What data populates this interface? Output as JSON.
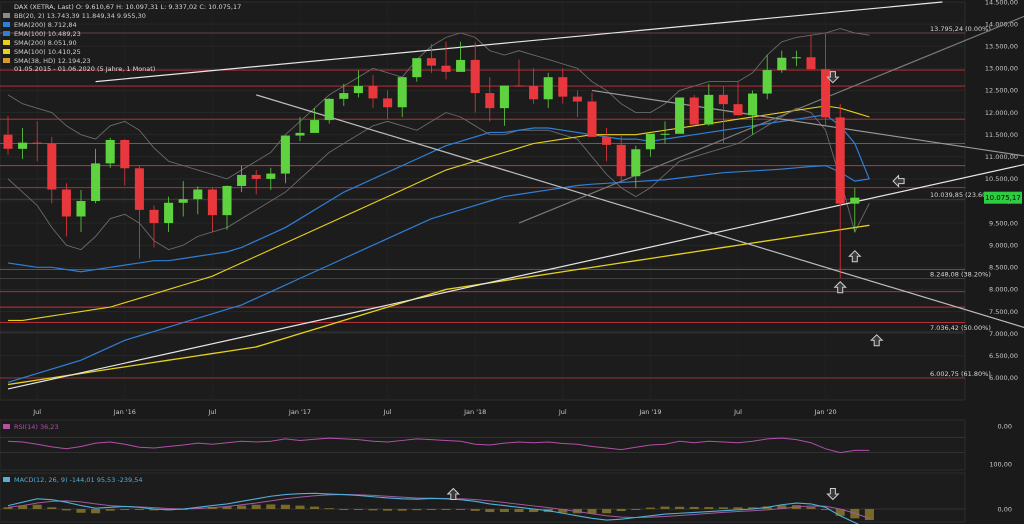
{
  "header": {
    "symbol_line": "DAX (XETRA, Last)  O: 9.610,67  H: 10.097,31  L: 9.337,02  C: 10.075,17",
    "date_range": "01.05.2015 - 01.06.2020  (5 Jahre, 1 Monat)"
  },
  "legend": [
    {
      "text": "BB(20, 2)  13.743,39  11.849,34  9.955,30",
      "color": "#8a8a8a"
    },
    {
      "text": "EMA(200)  8.712,84",
      "color": "#2f7fd6"
    },
    {
      "text": "EMA(100)  10.489,23",
      "color": "#2f7fd6"
    },
    {
      "text": "SMA(200)  8.051,90",
      "color": "#e6d21a"
    },
    {
      "text": "SMA(100)  10.410,25",
      "color": "#e6d21a"
    },
    {
      "text": "SMA(38, HD)  12.194,23",
      "color": "#d89c2a"
    }
  ],
  "last_price": {
    "label": "10.075,17",
    "color": "#2ecc40"
  },
  "colors": {
    "background": "#1a1a1a",
    "up": "#5fd33f",
    "down": "#e8383d",
    "hline": "#c8323a",
    "trend": "#e6e6e6",
    "bb": "#6a6a6a",
    "ema": "#2f7fd6",
    "sma": "#e6d21a",
    "sma38": "#c9962c",
    "rsi": "#b24fa8",
    "macd": "#4fb0d8",
    "signal": "#a05aa0",
    "hist": "#7a6a2a"
  },
  "chart_data": [
    {
      "type": "candlestick",
      "title": "DAX (XETRA, Last)",
      "y_scale": "linear",
      "ylim": [
        5500,
        14500
      ],
      "y_ticks": [
        14500,
        14000,
        13500,
        13000,
        12500,
        12000,
        11500,
        11000,
        10500,
        10000,
        9500,
        9000,
        8500,
        8000,
        7500,
        7000,
        6500,
        6000
      ],
      "y_tick_labels": [
        "14.500,00",
        "14.000,00",
        "13.500,00",
        "13.000,00",
        "12.500,00",
        "12.000,00",
        "11.500,00",
        "11.000,00",
        "10.500,00",
        "10.000,00",
        "9.500,00",
        "9.000,00",
        "8.500,00",
        "8.000,00",
        "7.500,00",
        "7.000,00",
        "6.500,00",
        "6.000,00"
      ],
      "x_labels": [
        {
          "label": "Jul",
          "month_index": 2
        },
        {
          "label": "Jan '16",
          "month_index": 8
        },
        {
          "label": "Jul",
          "month_index": 14
        },
        {
          "label": "Jan '17",
          "month_index": 20
        },
        {
          "label": "Jul",
          "month_index": 26
        },
        {
          "label": "Jan '18",
          "month_index": 32
        },
        {
          "label": "Jul",
          "month_index": 38
        },
        {
          "label": "Jan '19",
          "month_index": 44
        },
        {
          "label": "Jul",
          "month_index": 50
        },
        {
          "label": "Jan '20",
          "month_index": 56
        }
      ],
      "x_range_months": [
        0,
        65
      ],
      "candles": [
        [
          11500,
          11920,
          11050,
          11180
        ],
        [
          11180,
          11650,
          10950,
          11320
        ],
        [
          11320,
          11800,
          10900,
          11300
        ],
        [
          11300,
          11450,
          9950,
          10260
        ],
        [
          10260,
          10400,
          9200,
          9650
        ],
        [
          9650,
          10250,
          9300,
          10000
        ],
        [
          10000,
          11180,
          9950,
          10850
        ],
        [
          10850,
          11430,
          10750,
          11380
        ],
        [
          11380,
          11400,
          10350,
          10740
        ],
        [
          10740,
          10800,
          8700,
          9800
        ],
        [
          9800,
          9900,
          8950,
          9500
        ],
        [
          9500,
          10100,
          9300,
          9960
        ],
        [
          9960,
          10450,
          9650,
          10040
        ],
        [
          10040,
          10330,
          9700,
          10260
        ],
        [
          10260,
          10300,
          9300,
          9680
        ],
        [
          9680,
          10350,
          9350,
          10340
        ],
        [
          10340,
          10800,
          10200,
          10590
        ],
        [
          10590,
          10700,
          10150,
          10500
        ],
        [
          10500,
          10750,
          10250,
          10620
        ],
        [
          10620,
          11480,
          10400,
          11480
        ],
        [
          11480,
          11900,
          11350,
          11540
        ],
        [
          11540,
          12100,
          11600,
          11830
        ],
        [
          11830,
          12330,
          11750,
          12310
        ],
        [
          12310,
          12650,
          12150,
          12440
        ],
        [
          12440,
          12950,
          12340,
          12600
        ],
        [
          12600,
          12850,
          12100,
          12320
        ],
        [
          12320,
          12500,
          11850,
          12120
        ],
        [
          12120,
          12650,
          11900,
          12800
        ],
        [
          12800,
          13200,
          12700,
          13230
        ],
        [
          13230,
          13550,
          12900,
          13060
        ],
        [
          13060,
          13600,
          12750,
          12920
        ],
        [
          12920,
          13600,
          13050,
          13190
        ],
        [
          13190,
          13590,
          12000,
          12440
        ],
        [
          12440,
          12800,
          11800,
          12100
        ],
        [
          12100,
          12500,
          11700,
          12610
        ],
        [
          12610,
          13200,
          12600,
          12600
        ],
        [
          12600,
          13000,
          12200,
          12300
        ],
        [
          12300,
          12900,
          12100,
          12800
        ],
        [
          12800,
          13000,
          12200,
          12360
        ],
        [
          12360,
          12500,
          11900,
          12250
        ],
        [
          12250,
          12450,
          11500,
          11450
        ],
        [
          11450,
          11650,
          10900,
          11270
        ],
        [
          11270,
          11500,
          10400,
          10560
        ],
        [
          10560,
          11250,
          10300,
          11170
        ],
        [
          11170,
          11350,
          11000,
          11520
        ],
        [
          11520,
          11800,
          11300,
          11520
        ],
        [
          11520,
          12300,
          11600,
          12340
        ],
        [
          12340,
          12400,
          11800,
          11730
        ],
        [
          11730,
          12650,
          11700,
          12400
        ],
        [
          12400,
          12600,
          11300,
          12190
        ],
        [
          12190,
          12700,
          12000,
          11940
        ],
        [
          11940,
          12500,
          11500,
          12430
        ],
        [
          12430,
          13300,
          12300,
          12960
        ],
        [
          12960,
          13400,
          12900,
          13240
        ],
        [
          13240,
          13400,
          13050,
          13250
        ],
        [
          13250,
          13760,
          13100,
          12980
        ],
        [
          12980,
          13790,
          11700,
          11890
        ],
        [
          11890,
          12200,
          8250,
          9940
        ],
        [
          9940,
          10300,
          9300,
          10075
        ]
      ],
      "horizontal_lines": [
        13800,
        12960,
        12600,
        11850,
        11300,
        10800,
        10300,
        8450,
        7950,
        7600,
        7250,
        6000
      ],
      "fib_levels": [
        {
          "label": "13.795,24 (0.00%)",
          "value": 13800
        },
        {
          "label": "10.039,85 (23.60%)",
          "value": 10040
        },
        {
          "label": "8.248,08 (38.20%)",
          "value": 8250
        },
        {
          "label": "7.036,42 (50.00%)",
          "value": 7036
        },
        {
          "label": "6.002,75 (61.80%)",
          "value": 6003
        }
      ],
      "trendlines": [
        {
          "from": [
            6,
            12700
          ],
          "to": [
            64,
            14500
          ],
          "color": "#e6e6e6"
        },
        {
          "from": [
            0,
            5750
          ],
          "to": [
            72,
            11000
          ],
          "color": "#e6e6e6"
        },
        {
          "from": [
            17,
            12400
          ],
          "to": [
            72,
            6900
          ],
          "color": "#bdbdbd"
        },
        {
          "from": [
            40,
            12500
          ],
          "to": [
            72,
            10900
          ],
          "color": "#9a9a9a"
        },
        {
          "from": [
            35,
            9500
          ],
          "to": [
            72,
            14500
          ],
          "color": "#7a7a7a"
        }
      ],
      "ema200": [
        5900,
        6000,
        6100,
        6200,
        6300,
        6400,
        6550,
        6700,
        6850,
        6950,
        7050,
        7150,
        7250,
        7350,
        7450,
        7550,
        7650,
        7800,
        7950,
        8100,
        8250,
        8400,
        8550,
        8700,
        8850,
        9000,
        9150,
        9300,
        9450,
        9600,
        9700,
        9800,
        9900,
        10000,
        10100,
        10150,
        10200,
        10250,
        10300,
        10350,
        10380,
        10400,
        10420,
        10440,
        10460,
        10480,
        10520,
        10560,
        10600,
        10640,
        10660,
        10680,
        10700,
        10720,
        10750,
        10780,
        10800,
        10650,
        10450,
        10500
      ],
      "ema100": [
        8600,
        8550,
        8500,
        8500,
        8450,
        8400,
        8450,
        8500,
        8550,
        8600,
        8650,
        8650,
        8700,
        8750,
        8800,
        8850,
        8950,
        9100,
        9250,
        9400,
        9600,
        9800,
        10000,
        10200,
        10350,
        10500,
        10650,
        10800,
        10950,
        11100,
        11250,
        11350,
        11450,
        11550,
        11550,
        11600,
        11650,
        11650,
        11600,
        11550,
        11500,
        11450,
        11400,
        11400,
        11350,
        11400,
        11450,
        11500,
        11550,
        11600,
        11650,
        11700,
        11750,
        11800,
        11850,
        11900,
        11950,
        11700,
        11300,
        10490
      ],
      "sma200": [
        5850,
        5900,
        5950,
        6000,
        6050,
        6100,
        6150,
        6200,
        6250,
        6300,
        6350,
        6400,
        6450,
        6500,
        6550,
        6600,
        6650,
        6700,
        6800,
        6900,
        7000,
        7100,
        7200,
        7300,
        7400,
        7500,
        7600,
        7700,
        7800,
        7900,
        8000,
        8050,
        8100,
        8150,
        8200,
        8250,
        8300,
        8350,
        8400,
        8450,
        8500,
        8550,
        8600,
        8650,
        8700,
        8750,
        8800,
        8850,
        8900,
        8950,
        9000,
        9050,
        9100,
        9150,
        9200,
        9250,
        9300,
        9350,
        9400,
        9450
      ],
      "sma100": [
        7300,
        7300,
        7350,
        7400,
        7450,
        7500,
        7550,
        7600,
        7700,
        7800,
        7900,
        8000,
        8100,
        8200,
        8300,
        8450,
        8600,
        8750,
        8900,
        9050,
        9200,
        9350,
        9500,
        9650,
        9800,
        9950,
        10100,
        10250,
        10400,
        10550,
        10700,
        10800,
        10900,
        11000,
        11100,
        11200,
        11300,
        11350,
        11400,
        11450,
        11500,
        11500,
        11500,
        11500,
        11550,
        11600,
        11650,
        11700,
        11750,
        11800,
        11850,
        11900,
        11950,
        12000,
        12050,
        12100,
        12150,
        12100,
        12000,
        11900
      ],
      "bb_upper": [
        12400,
        12200,
        12100,
        12000,
        11700,
        11500,
        11400,
        11700,
        11800,
        11600,
        11200,
        10900,
        10800,
        10700,
        10600,
        10500,
        10700,
        10900,
        11100,
        11500,
        11800,
        12100,
        12400,
        12600,
        12800,
        13000,
        12900,
        12800,
        13200,
        13500,
        13700,
        13800,
        13700,
        13400,
        13300,
        13400,
        13300,
        13200,
        13100,
        13000,
        12700,
        12500,
        12200,
        12000,
        12000,
        12200,
        12500,
        12600,
        12700,
        12700,
        12700,
        12900,
        13300,
        13600,
        13700,
        13750,
        13800,
        13900,
        13800,
        13750
      ],
      "bb_lower": [
        10500,
        10200,
        9900,
        9400,
        9000,
        8900,
        9200,
        9600,
        9700,
        9500,
        9100,
        8900,
        9000,
        9200,
        9300,
        9400,
        9600,
        9800,
        10000,
        10200,
        10500,
        10800,
        11100,
        11300,
        11500,
        11700,
        11800,
        11700,
        11600,
        11800,
        12000,
        11900,
        11700,
        11500,
        11500,
        11600,
        11600,
        11600,
        11500,
        11400,
        11000,
        10600,
        10300,
        10100,
        10300,
        10600,
        10900,
        11000,
        11100,
        11200,
        11300,
        11500,
        11700,
        11900,
        12100,
        12000,
        11600,
        10500,
        9300,
        9950
      ],
      "markers": [
        {
          "month": 56.5,
          "value": 12800,
          "direction": "down"
        },
        {
          "month": 61,
          "value": 10450,
          "direction": "left"
        },
        {
          "month": 58,
          "value": 8750,
          "direction": "up"
        },
        {
          "month": 57,
          "value": 8050,
          "direction": "up"
        },
        {
          "month": 59.5,
          "value": 6850,
          "direction": "up"
        }
      ]
    },
    {
      "type": "line",
      "title": "RSI(14)  36,23",
      "ylim": [
        0,
        100
      ],
      "y_tick_labels": [
        "100,00",
        "0,00"
      ],
      "values": [
        60,
        58,
        52,
        45,
        40,
        46,
        55,
        58,
        52,
        44,
        42,
        46,
        50,
        55,
        52,
        56,
        60,
        58,
        60,
        66,
        62,
        65,
        68,
        66,
        64,
        60,
        58,
        62,
        66,
        64,
        62,
        60,
        52,
        50,
        55,
        58,
        56,
        58,
        54,
        52,
        46,
        42,
        38,
        44,
        50,
        52,
        60,
        56,
        60,
        58,
        56,
        60,
        66,
        68,
        64,
        56,
        40,
        30,
        36,
        36
      ]
    },
    {
      "type": "bar+line",
      "title": "MACD(12, 26, 9)  -144,01  95,53  -239,54",
      "y_tick_labels": [
        "0,00"
      ],
      "macd": [
        20,
        40,
        60,
        55,
        40,
        20,
        5,
        10,
        15,
        10,
        0,
        -5,
        0,
        10,
        20,
        30,
        45,
        60,
        75,
        85,
        90,
        92,
        88,
        85,
        80,
        72,
        65,
        60,
        58,
        62,
        60,
        55,
        45,
        30,
        20,
        10,
        0,
        -10,
        -25,
        -40,
        -55,
        -65,
        -60,
        -50,
        -40,
        -30,
        -25,
        -20,
        -15,
        -10,
        -5,
        0,
        10,
        25,
        35,
        30,
        10,
        -40,
        -80,
        -120
      ],
      "signal": [
        10,
        20,
        35,
        45,
        48,
        42,
        30,
        20,
        15,
        12,
        8,
        3,
        0,
        3,
        8,
        15,
        25,
        35,
        48,
        60,
        70,
        78,
        83,
        85,
        84,
        80,
        75,
        70,
        65,
        63,
        62,
        60,
        56,
        48,
        38,
        28,
        18,
        8,
        -3,
        -15,
        -28,
        -40,
        -48,
        -50,
        -48,
        -44,
        -38,
        -32,
        -26,
        -20,
        -15,
        -10,
        -5,
        3,
        12,
        18,
        16,
        0,
        -25,
        -55
      ],
      "markers": [
        {
          "month": 30.5,
          "direction": "up"
        },
        {
          "month": 56.5,
          "direction": "down"
        }
      ]
    }
  ]
}
